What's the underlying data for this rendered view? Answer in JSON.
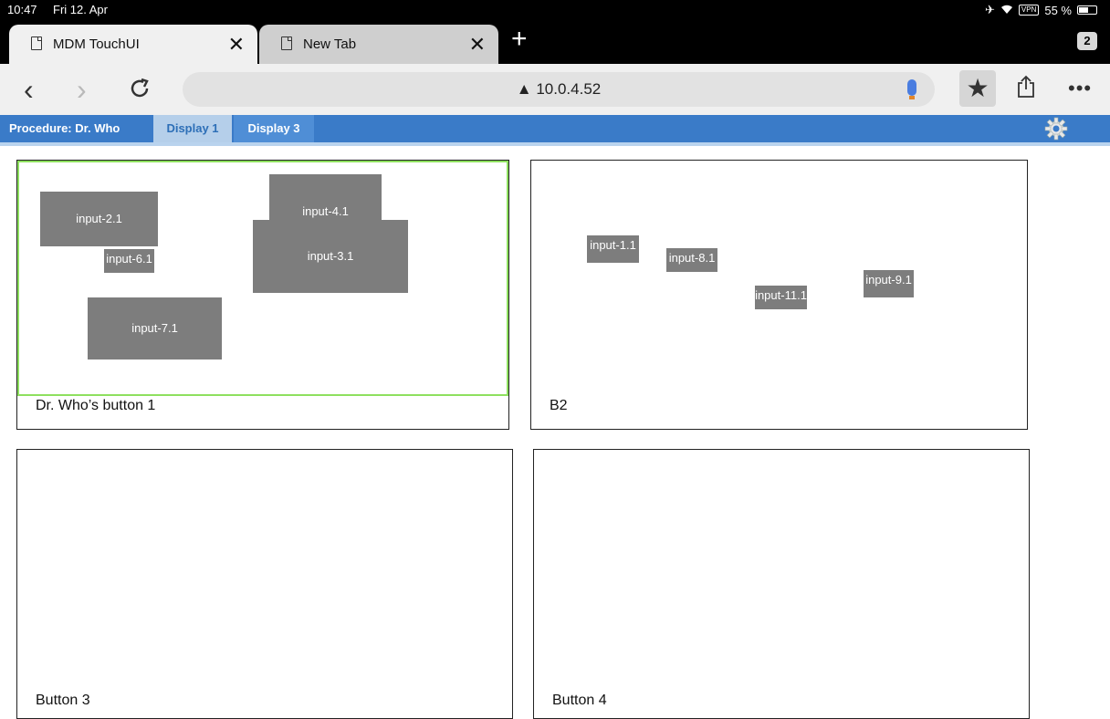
{
  "status": {
    "time": "10:47",
    "date": "Fri 12. Apr",
    "vpn": "VPN",
    "battery": "55 %",
    "battery_level": 0.55
  },
  "tabs": [
    {
      "title": "MDM TouchUI",
      "active": true
    },
    {
      "title": "New Tab",
      "active": false
    }
  ],
  "tab_count": "2",
  "address": {
    "url": "10.0.4.52",
    "warning_icon": "warning-triangle-icon"
  },
  "appnav": {
    "procedure": "Procedure: Dr. Who",
    "items": [
      "Display 1",
      "Display 3"
    ]
  },
  "panels": [
    {
      "label": "Dr. Who’s button 1",
      "inputs": [
        "input-2.1",
        "input-6.1",
        "input-4.1",
        "input-3.1",
        "input-7.1"
      ]
    },
    {
      "label": "B2",
      "inputs": [
        "input-1.1",
        "input-8.1",
        "input-11.1",
        "input-9.1"
      ]
    },
    {
      "label": "Button 3",
      "inputs": []
    },
    {
      "label": "Button 4",
      "inputs": []
    }
  ],
  "colors": {
    "nav_bar": "#3a7bc8",
    "active_tab": "#b5cfea",
    "canvas_border": "#8ee05f",
    "input_box": "#7d7d7d"
  }
}
